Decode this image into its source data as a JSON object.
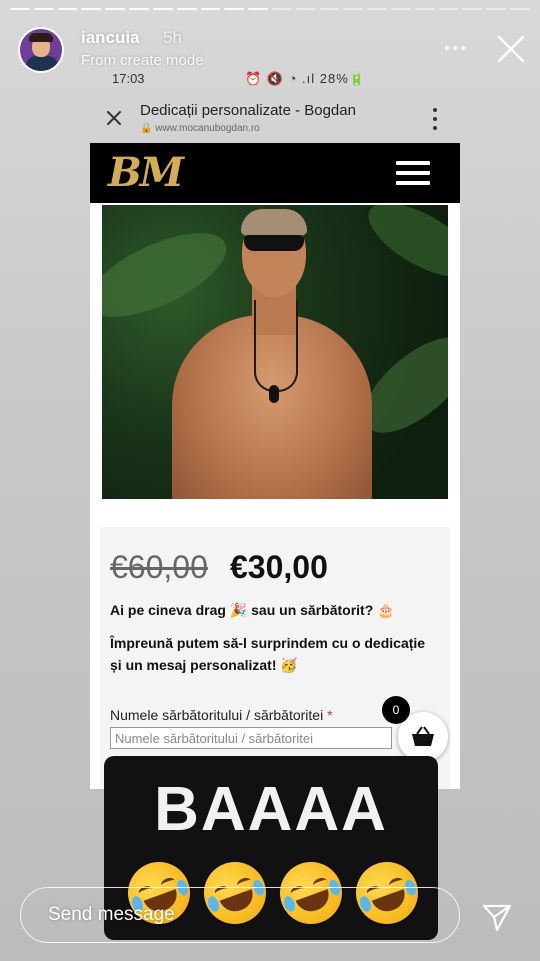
{
  "story": {
    "username": "iancuia",
    "time_ago": "5h",
    "mode_label": "From create mode",
    "progress": {
      "segments_total": 22,
      "segments_viewed": 11
    },
    "message_placeholder": "Send message"
  },
  "phone": {
    "status_time": "17:03",
    "status_icons": "⏰ 🔇 ◔ .ıl 28%🔋",
    "page_title": "Dedicații personalizate - Bogdan",
    "url": "www.mocanubogdan.ro"
  },
  "site": {
    "logo_text": "BM",
    "old_price": "€60,00",
    "new_price": "€30,00",
    "line1": "Ai pe cineva drag 🎉 sau un sărbătorit? 🎂",
    "line2": "Împreună putem să-l surprindem cu o dedicație și un mesaj personalizat! 🥳",
    "field_label": "Numele sărbătoritului / sărbătoritei",
    "field_required_mark": "*",
    "field_placeholder": "Numele sărbătoritului / sărbătoritei",
    "cart_count": "0"
  },
  "sticker": {
    "text": "BAAAA",
    "emoji_count": 4,
    "emoji_name": "rolling-on-the-floor-laughing"
  },
  "colors": {
    "site_header_bg": "#000000",
    "logo_gold": "#d2ad55",
    "sticker_bg": "#111111",
    "required_red": "#c0392b"
  }
}
